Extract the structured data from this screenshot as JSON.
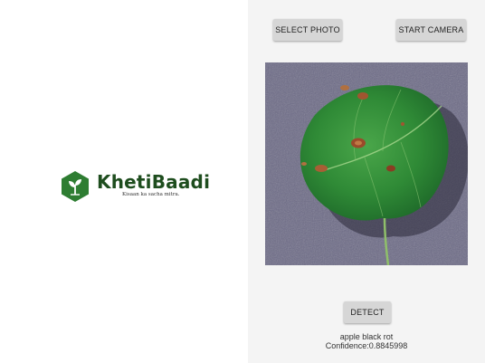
{
  "brand": {
    "name": "KhetiBaadi",
    "tagline": "Kisaan ka sacha mitra.",
    "primary_color": "#2e7d32",
    "icon": "leaf-sprout-icon"
  },
  "toolbar": {
    "select_photo_label": "SELECT PHOTO",
    "start_camera_label": "START CAMERA"
  },
  "preview": {
    "image_subject": "apple-leaf-photo"
  },
  "actions": {
    "detect_label": "DETECT"
  },
  "result": {
    "prediction": "apple black rot",
    "confidence": "Confidence:0.8845998"
  }
}
